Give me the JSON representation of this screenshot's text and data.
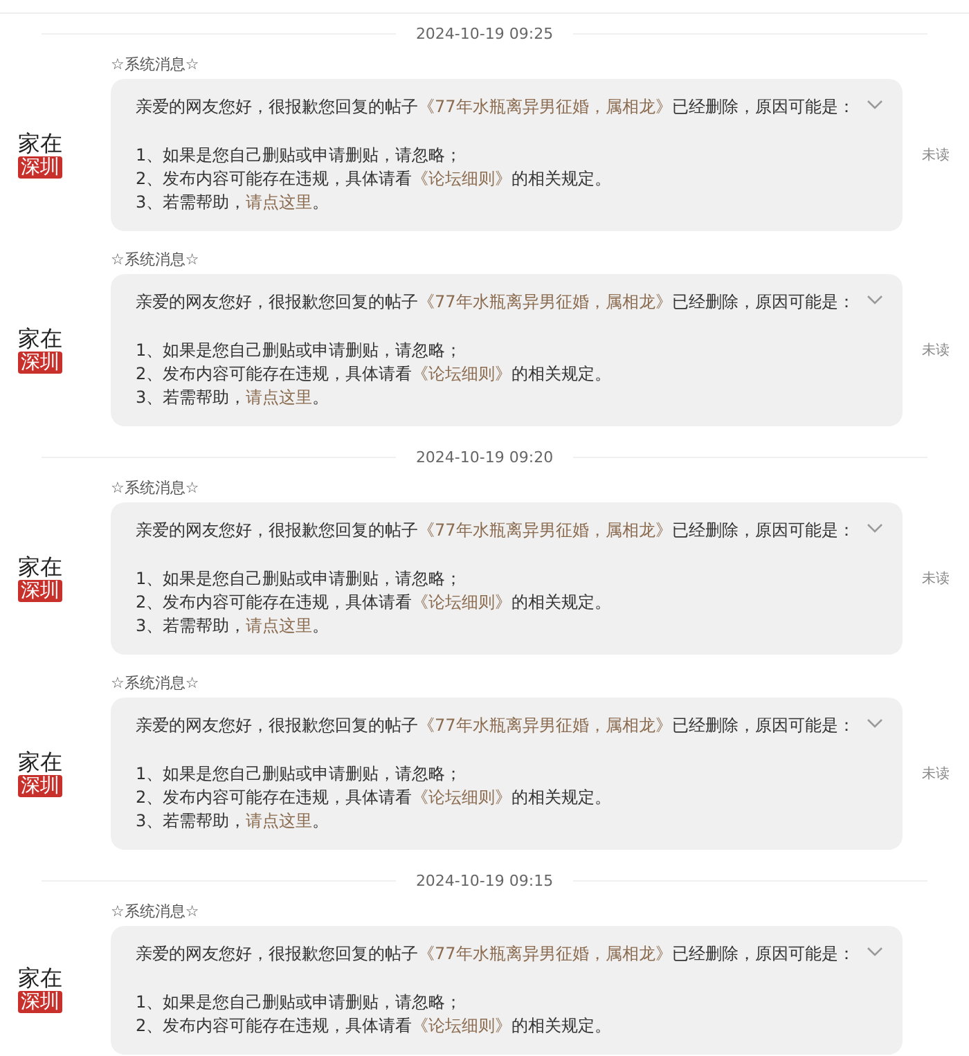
{
  "groups": [
    {
      "date": "2024-10-19 09:25",
      "messages": [
        {
          "header": "☆系统消息☆",
          "avatar": {
            "top": "家在",
            "bottom": "深圳"
          },
          "status": "未读",
          "intro": [
            {
              "kind": "plain",
              "text": "亲爱的网友您好，很报歉您回复的帖子"
            },
            {
              "kind": "link",
              "text": "《77年水瓶离异男征婚，属相龙》"
            },
            {
              "kind": "plain",
              "text": "已经删除，原因可能是："
            }
          ],
          "items": [
            [
              {
                "kind": "plain",
                "text": "1、如果是您自己删贴或申请删贴，请忽略；"
              }
            ],
            [
              {
                "kind": "plain",
                "text": "2、发布内容可能存在违规，具体请看"
              },
              {
                "kind": "link",
                "text": "《论坛细则》"
              },
              {
                "kind": "plain",
                "text": "的相关规定。"
              }
            ],
            [
              {
                "kind": "plain",
                "text": "3、若需帮助，"
              },
              {
                "kind": "link",
                "text": "请点这里"
              },
              {
                "kind": "plain",
                "text": "。"
              }
            ]
          ]
        },
        {
          "header": "☆系统消息☆",
          "avatar": {
            "top": "家在",
            "bottom": "深圳"
          },
          "status": "未读",
          "intro": [
            {
              "kind": "plain",
              "text": "亲爱的网友您好，很报歉您回复的帖子"
            },
            {
              "kind": "link",
              "text": "《77年水瓶离异男征婚，属相龙》"
            },
            {
              "kind": "plain",
              "text": "已经删除，原因可能是："
            }
          ],
          "items": [
            [
              {
                "kind": "plain",
                "text": "1、如果是您自己删贴或申请删贴，请忽略；"
              }
            ],
            [
              {
                "kind": "plain",
                "text": "2、发布内容可能存在违规，具体请看"
              },
              {
                "kind": "link",
                "text": "《论坛细则》"
              },
              {
                "kind": "plain",
                "text": "的相关规定。"
              }
            ],
            [
              {
                "kind": "plain",
                "text": "3、若需帮助，"
              },
              {
                "kind": "link",
                "text": "请点这里"
              },
              {
                "kind": "plain",
                "text": "。"
              }
            ]
          ]
        }
      ]
    },
    {
      "date": "2024-10-19 09:20",
      "messages": [
        {
          "header": "☆系统消息☆",
          "avatar": {
            "top": "家在",
            "bottom": "深圳"
          },
          "status": "未读",
          "intro": [
            {
              "kind": "plain",
              "text": "亲爱的网友您好，很报歉您回复的帖子"
            },
            {
              "kind": "link",
              "text": "《77年水瓶离异男征婚，属相龙》"
            },
            {
              "kind": "plain",
              "text": "已经删除，原因可能是："
            }
          ],
          "items": [
            [
              {
                "kind": "plain",
                "text": "1、如果是您自己删贴或申请删贴，请忽略；"
              }
            ],
            [
              {
                "kind": "plain",
                "text": "2、发布内容可能存在违规，具体请看"
              },
              {
                "kind": "link",
                "text": "《论坛细则》"
              },
              {
                "kind": "plain",
                "text": "的相关规定。"
              }
            ],
            [
              {
                "kind": "plain",
                "text": "3、若需帮助，"
              },
              {
                "kind": "link",
                "text": "请点这里"
              },
              {
                "kind": "plain",
                "text": "。"
              }
            ]
          ]
        },
        {
          "header": "☆系统消息☆",
          "avatar": {
            "top": "家在",
            "bottom": "深圳"
          },
          "status": "未读",
          "intro": [
            {
              "kind": "plain",
              "text": "亲爱的网友您好，很报歉您回复的帖子"
            },
            {
              "kind": "link",
              "text": "《77年水瓶离异男征婚，属相龙》"
            },
            {
              "kind": "plain",
              "text": "已经删除，原因可能是："
            }
          ],
          "items": [
            [
              {
                "kind": "plain",
                "text": "1、如果是您自己删贴或申请删贴，请忽略；"
              }
            ],
            [
              {
                "kind": "plain",
                "text": "2、发布内容可能存在违规，具体请看"
              },
              {
                "kind": "link",
                "text": "《论坛细则》"
              },
              {
                "kind": "plain",
                "text": "的相关规定。"
              }
            ],
            [
              {
                "kind": "plain",
                "text": "3、若需帮助，"
              },
              {
                "kind": "link",
                "text": "请点这里"
              },
              {
                "kind": "plain",
                "text": "。"
              }
            ]
          ]
        }
      ]
    },
    {
      "date": "2024-10-19 09:15",
      "messages": [
        {
          "header": "☆系统消息☆",
          "avatar": {
            "top": "家在",
            "bottom": "深圳"
          },
          "intro": [
            {
              "kind": "plain",
              "text": "亲爱的网友您好，很报歉您回复的帖子"
            },
            {
              "kind": "link",
              "text": "《77年水瓶离异男征婚，属相龙》"
            },
            {
              "kind": "plain",
              "text": "已经删除，原因可能是："
            }
          ],
          "items": [
            [
              {
                "kind": "plain",
                "text": "1、如果是您自己删贴或申请删贴，请忽略；"
              }
            ],
            [
              {
                "kind": "plain",
                "text": "2、发布内容可能存在违规，具体请看"
              },
              {
                "kind": "link",
                "text": "《论坛细则》"
              },
              {
                "kind": "plain",
                "text": "的相关规定。"
              }
            ]
          ]
        }
      ]
    }
  ]
}
